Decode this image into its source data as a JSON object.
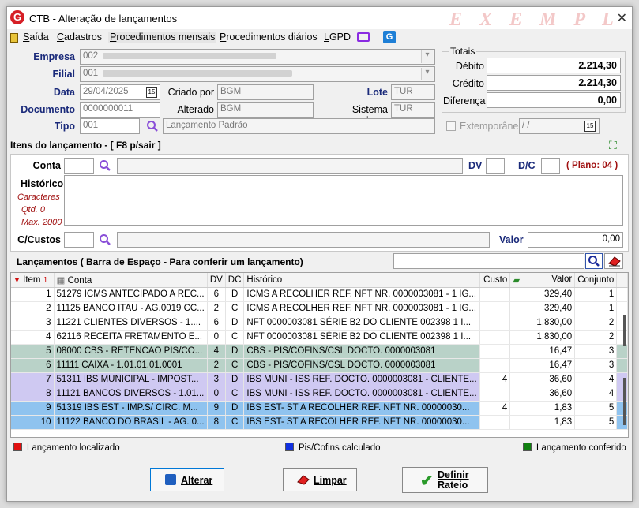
{
  "window": {
    "title": "CTB - Alteração de lançamentos",
    "watermark": "E X E M P L O",
    "logo_letter": "G"
  },
  "menu": {
    "items": [
      {
        "label": "Saída",
        "underline": "S",
        "rest": "aída"
      },
      {
        "label": "Cadastros",
        "underline": "C",
        "rest": "adastros"
      },
      {
        "label": "Procedimentos mensais",
        "underline": "P",
        "rest": "rocedimentos mensais"
      },
      {
        "label": "Procedimentos diários",
        "underline": "P",
        "rest": "rocedimentos diários"
      },
      {
        "label": "LGPD",
        "underline": "L",
        "rest": "GPD"
      }
    ]
  },
  "form": {
    "empresa_label": "Empresa",
    "empresa_value": "002",
    "filial_label": "Filial",
    "filial_value": "001",
    "data_label": "Data",
    "data_value": "29/04/2025",
    "criado_por_label": "Criado por",
    "criado_por_value": "BGM",
    "lote_label": "Lote",
    "lote_value": "TUR",
    "documento_label": "Documento",
    "documento_value": "0000000011",
    "alterado_por_label": "Alterado por",
    "alterado_por_value": "BGM",
    "sistema_origem_label": "Sistema origem",
    "sistema_origem_value": "TUR",
    "tipo_label": "Tipo",
    "tipo_value": "001",
    "tipo_desc": "Lançamento Padrão",
    "extemporaneo_label": "Extemporâneo",
    "extemporaneo_date": " / /"
  },
  "totais": {
    "title": "Totais",
    "debito_label": "Débito",
    "debito_value": "2.214,30",
    "credito_label": "Crédito",
    "credito_value": "2.214,30",
    "diferenca_label": "Diferença",
    "diferenca_value": "0,00"
  },
  "itens": {
    "header": "Itens do lançamento - [ F8 p/sair ]",
    "conta_label": "Conta",
    "dv_label": "DV",
    "dc_label": "D/C",
    "plano": "( Plano: 04 )",
    "historico_label": "Histórico",
    "caracteres_label": "Caracteres",
    "qtd_label": "Qtd. 0",
    "max_label": "Max. 2000",
    "ccustos_label": "C/Custos",
    "valor_label": "Valor",
    "valor_value": "0,00"
  },
  "lancamentos": {
    "header": "Lançamentos ( Barra de Espaço - Para conferir um lançamento)",
    "columns": [
      "Item",
      "Conta",
      "DV",
      "DC",
      "Histórico",
      "Custo",
      "",
      "Valor",
      "Conjunto"
    ],
    "rows": [
      {
        "item": "1",
        "conta": "51279 ICMS ANTECIPADO A REC...",
        "dv": "6",
        "dc": "D",
        "historico": "ICMS A RECOLHER REF. NFT NR. 0000003081 - 1 IG...",
        "custo": "",
        "valor": "329,40",
        "conjunto": "1",
        "bg": "#ffffff"
      },
      {
        "item": "2",
        "conta": "11125 BANCO ITAU - AG.0019 CC...",
        "dv": "2",
        "dc": "C",
        "historico": "ICMS A RECOLHER REF. NFT NR. 0000003081 - 1 IG...",
        "custo": "",
        "valor": "329,40",
        "conjunto": "1",
        "bg": "#ffffff"
      },
      {
        "item": "3",
        "conta": "11221 CLIENTES DIVERSOS - 1....",
        "dv": "6",
        "dc": "D",
        "historico": "NFT 0000003081 SÉRIE B2 DO CLIENTE 002398 1 I...",
        "custo": "",
        "valor": "1.830,00",
        "conjunto": "2",
        "bg": "#ffffff"
      },
      {
        "item": "4",
        "conta": "62116 RECEITA FRETAMENTO E...",
        "dv": "0",
        "dc": "C",
        "historico": "NFT 0000003081 SÉRIE B2 DO CLIENTE 002398 1 I...",
        "custo": "",
        "valor": "1.830,00",
        "conjunto": "2",
        "bg": "#ffffff"
      },
      {
        "item": "5",
        "conta": "08000 CBS - RETENCAO PIS/CO...",
        "dv": "4",
        "dc": "D",
        "historico": "CBS - PIS/COFINS/CSL DOCTO. 0000003081",
        "custo": "",
        "valor": "16,47",
        "conjunto": "3",
        "bg": "#b9d2c8"
      },
      {
        "item": "6",
        "conta": "11111 CAIXA - 1.01.01.01.0001",
        "dv": "2",
        "dc": "C",
        "historico": "CBS - PIS/COFINS/CSL DOCTO. 0000003081",
        "custo": "",
        "valor": "16,47",
        "conjunto": "3",
        "bg": "#b9d2c8"
      },
      {
        "item": "7",
        "conta": "51311 IBS MUNICIPAL - IMPOST...",
        "dv": "3",
        "dc": "D",
        "historico": "IBS MUNI - ISS REF. DOCTO. 0000003081 - CLIENTE...",
        "custo": "4",
        "valor": "36,60",
        "conjunto": "4",
        "bg": "#cfc9f2"
      },
      {
        "item": "8",
        "conta": "11121 BANCOS DIVERSOS - 1.01...",
        "dv": "0",
        "dc": "C",
        "historico": "IBS MUNI - ISS REF. DOCTO. 0000003081 - CLIENTE...",
        "custo": "",
        "valor": "36,60",
        "conjunto": "4",
        "bg": "#cfc9f2"
      },
      {
        "item": "9",
        "conta": "51319 IBS EST - IMP.S/ CIRC. M...",
        "dv": "9",
        "dc": "D",
        "historico": "IBS EST- ST A RECOLHER REF. NFT NR. 00000030...",
        "custo": "4",
        "valor": "1,83",
        "conjunto": "5",
        "bg": "#8fc3ef"
      },
      {
        "item": "10",
        "conta": "11122 BANCO DO BRASIL - AG. 0...",
        "dv": "8",
        "dc": "C",
        "historico": "IBS EST- ST A RECOLHER REF. NFT NR. 00000030...",
        "custo": "",
        "valor": "1,83",
        "conjunto": "5",
        "bg": "#8fc3ef"
      }
    ]
  },
  "legend": {
    "localizado": "Lançamento localizado",
    "localizado_color": "#e01010",
    "pis_cofins": "Pis/Cofins calculado",
    "pis_cofins_color": "#1030e0",
    "conferido": "Lançamento conferido",
    "conferido_color": "#108010"
  },
  "buttons": {
    "alterar": "Alterar",
    "limpar": "Limpar",
    "definir_line1": "Definir",
    "definir_line2": "Rateio"
  },
  "icons": {
    "calendar": "15",
    "expand": "⛶"
  }
}
